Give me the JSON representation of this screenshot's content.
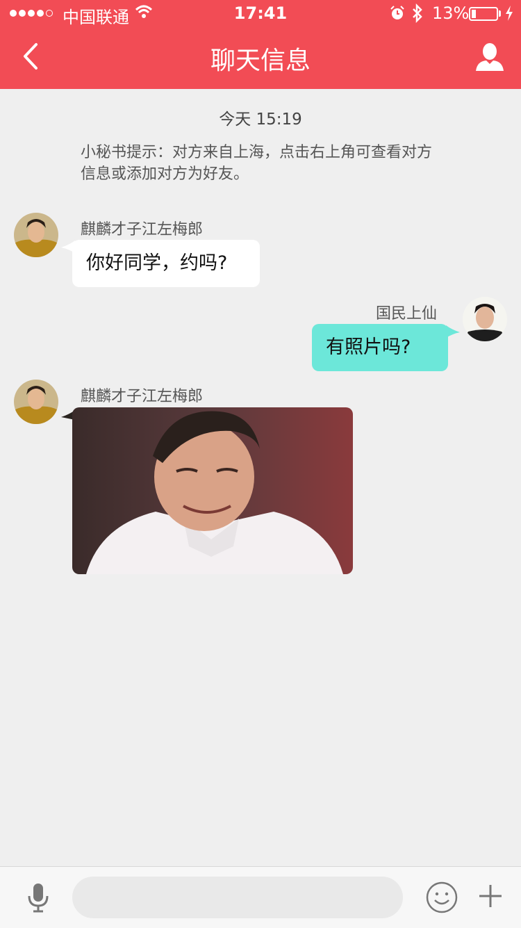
{
  "status_bar": {
    "carrier": "中国联通",
    "time": "17:41",
    "battery": "13%",
    "signal_bars": 4,
    "battery_level": 0.13
  },
  "nav": {
    "title": "聊天信息",
    "back_icon": "chevron-left-icon",
    "right_icon": "user-icon"
  },
  "chat": {
    "timestamp": "今天 15:19",
    "system_tip": "小秘书提示：对方来自上海，点击右上角可查看对方信息或添加对方为好友。",
    "messages": [
      {
        "sender": "麒麟才子江左梅郎",
        "side": "left",
        "text": "你好同学，约吗?"
      },
      {
        "sender": "国民上仙",
        "side": "right",
        "text": "有照片吗?"
      },
      {
        "sender": "麒麟才子江左梅郎",
        "side": "left",
        "type": "image"
      }
    ]
  },
  "input_bar": {
    "placeholder": "",
    "icons": [
      "microphone-icon",
      "emoji-icon",
      "plus-icon"
    ]
  },
  "colors": {
    "header": "#f24c55",
    "background": "#efefef",
    "bubble_left": "#ffffff",
    "bubble_right": "#6ce7d9"
  }
}
